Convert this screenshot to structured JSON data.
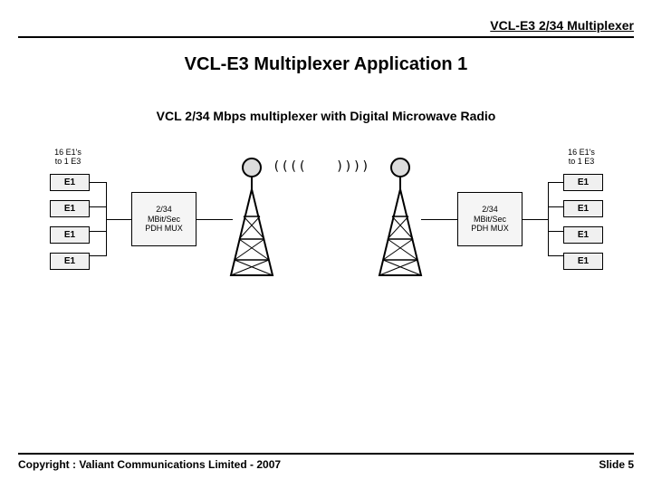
{
  "header": {
    "product": "VCL-E3 2/34 Multiplexer"
  },
  "title": "VCL-E3 Multiplexer Application 1",
  "diagram": {
    "subtitle": "VCL 2/34 Mbps multiplexer with Digital Microwave Radio",
    "left_label_l1": "16 E1's",
    "left_label_l2": "to 1 E3",
    "right_label_l1": "16 E1's",
    "right_label_l2": "to 1 E3",
    "e1": "E1",
    "mux_l1": "2/34",
    "mux_l2": "MBit/Sec",
    "mux_l3": "PDH MUX",
    "waves_left": "((((",
    "waves_right": "))))"
  },
  "footer": {
    "copyright": "Copyright : Valiant Communications Limited - 2007",
    "slide": "Slide 5"
  }
}
